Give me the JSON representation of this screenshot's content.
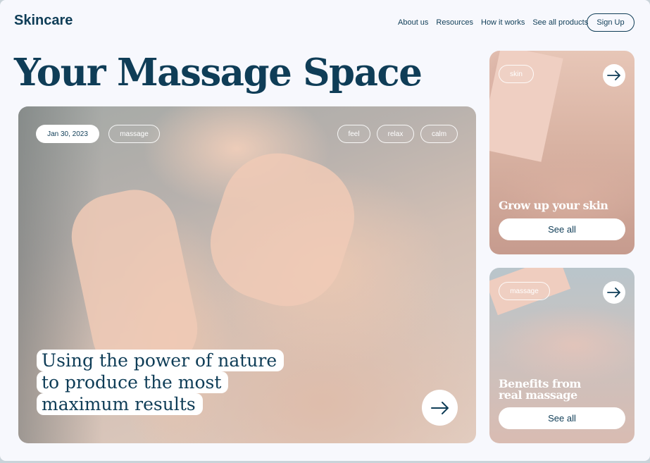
{
  "header": {
    "logo": "Skincare",
    "nav": [
      "About us",
      "Resources",
      "How it works",
      "See all products"
    ],
    "signup_label": "Sign Up"
  },
  "headline": "Your Massage Space",
  "hero": {
    "date": "Jan 30, 2023",
    "category": "massage",
    "tags": [
      "feel",
      "relax",
      "calm"
    ],
    "caption_lines": [
      "Using the power of nature",
      "to produce the most",
      "maximum results"
    ],
    "arrow_icon": "arrow-right-icon"
  },
  "cards": [
    {
      "tag": "skin",
      "title": "Grow up your skin",
      "button": "See all",
      "arrow_icon": "arrow-right-icon"
    },
    {
      "tag": "massage",
      "title_lines": [
        "Benefits from",
        "real massage"
      ],
      "button": "See all",
      "arrow_icon": "arrow-right-icon"
    }
  ],
  "colors": {
    "primary": "#0f3d57",
    "background": "#f7f8fd",
    "surface": "#ffffff"
  }
}
